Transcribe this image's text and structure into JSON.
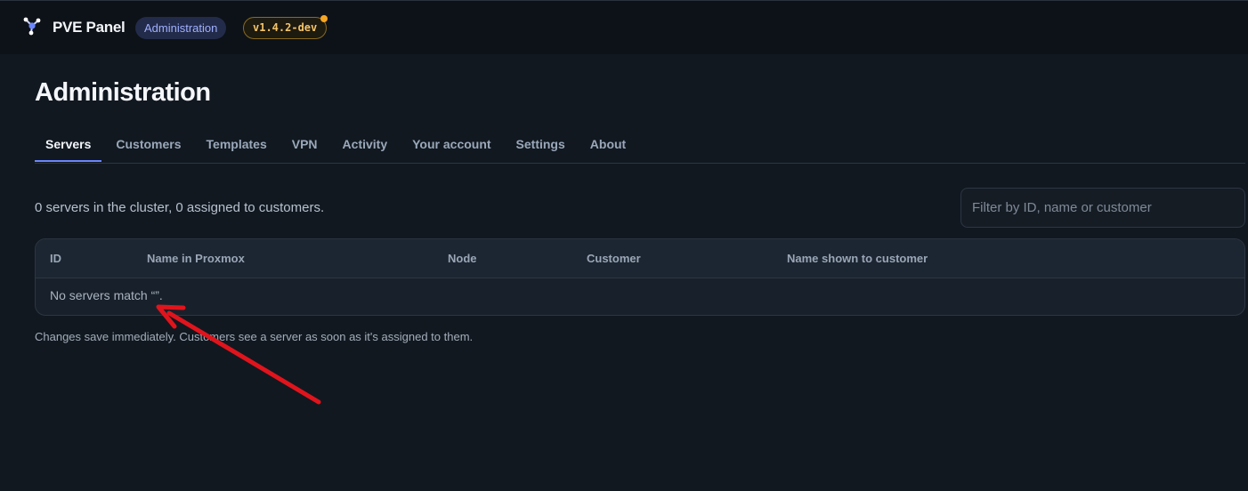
{
  "header": {
    "brand_name": "PVE Panel",
    "brand_icon": "network-nodes-icon",
    "section_badge": "Administration",
    "version_badge": "v1.4.2-dev"
  },
  "page": {
    "title": "Administration"
  },
  "tabs": [
    {
      "label": "Servers",
      "active": true
    },
    {
      "label": "Customers",
      "active": false
    },
    {
      "label": "Templates",
      "active": false
    },
    {
      "label": "VPN",
      "active": false
    },
    {
      "label": "Activity",
      "active": false
    },
    {
      "label": "Your account",
      "active": false
    },
    {
      "label": "Settings",
      "active": false
    },
    {
      "label": "About",
      "active": false
    }
  ],
  "servers": {
    "summary": "0 servers in the cluster, 0 assigned to customers.",
    "filter": {
      "placeholder": "Filter by ID, name or customer",
      "value": ""
    },
    "columns": [
      "ID",
      "Name in Proxmox",
      "Node",
      "Customer",
      "Name shown to customer"
    ],
    "rows": [],
    "empty_message": "No servers match “”.",
    "footnote": "Changes save immediately. Customers see a server as soon as it's assigned to them."
  },
  "colors": {
    "background": "#111820",
    "topbar": "#0d1218",
    "accent": "#6b86ff",
    "version_badge_text": "#f3c46a",
    "version_dot": "#f5a524",
    "annotation_arrow": "#e0141c"
  }
}
